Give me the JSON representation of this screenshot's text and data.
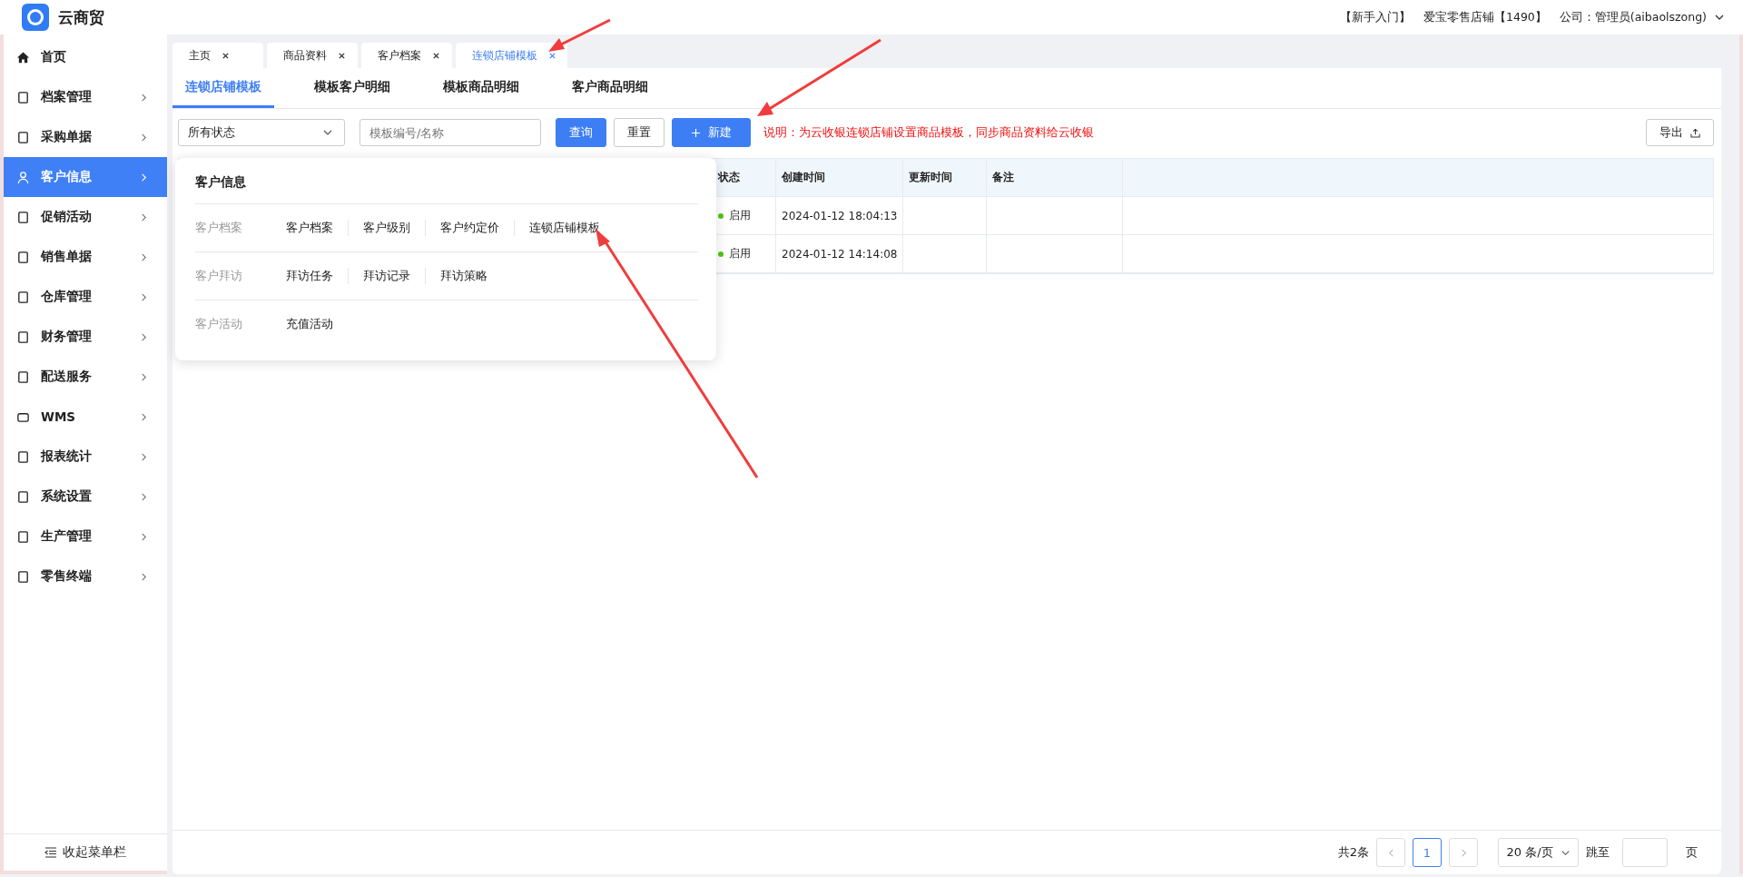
{
  "header": {
    "app_name": "云商贸",
    "links": [
      "【新手入门】",
      "爱宝零售店铺【1490】",
      "公司：管理员(aibaolszong)"
    ]
  },
  "sidebar": {
    "items": [
      {
        "label": "首页",
        "selected": false,
        "has_submenu": false
      },
      {
        "label": "档案管理",
        "selected": false,
        "has_submenu": true
      },
      {
        "label": "采购单据",
        "selected": false,
        "has_submenu": true
      },
      {
        "label": "客户信息",
        "selected": true,
        "has_submenu": true
      },
      {
        "label": "促销活动",
        "selected": false,
        "has_submenu": true
      },
      {
        "label": "销售单据",
        "selected": false,
        "has_submenu": true
      },
      {
        "label": "仓库管理",
        "selected": false,
        "has_submenu": true
      },
      {
        "label": "财务管理",
        "selected": false,
        "has_submenu": true
      },
      {
        "label": "配送服务",
        "selected": false,
        "has_submenu": true
      },
      {
        "label": "WMS",
        "selected": false,
        "has_submenu": true
      },
      {
        "label": "报表统计",
        "selected": false,
        "has_submenu": true
      },
      {
        "label": "系统设置",
        "selected": false,
        "has_submenu": true
      },
      {
        "label": "生产管理",
        "selected": false,
        "has_submenu": true
      },
      {
        "label": "零售终端",
        "selected": false,
        "has_submenu": true
      }
    ],
    "collapse_label": "收起菜单栏"
  },
  "page_tabs": [
    {
      "label": "主页",
      "selected": false
    },
    {
      "label": "商品资料",
      "selected": false
    },
    {
      "label": "客户档案",
      "selected": false
    },
    {
      "label": "连锁店铺模板",
      "selected": true
    }
  ],
  "sub_tabs": [
    {
      "label": "连锁店铺模板",
      "selected": true
    },
    {
      "label": "模板客户明细",
      "selected": false
    },
    {
      "label": "模板商品明细",
      "selected": false
    },
    {
      "label": "客户商品明细",
      "selected": false
    }
  ],
  "toolbar": {
    "status_select": "所有状态",
    "search": {
      "placeholder": "模板编号/名称"
    },
    "query_button": "查询",
    "reset_button": "重置",
    "new_button": "新建",
    "note": "说明：为云收银连锁店铺设置商品模板，同步商品资料给云收银",
    "export_button": "导出"
  },
  "table": {
    "columns": [
      "状态",
      "创建时间",
      "更新时间",
      "备注"
    ],
    "rows": [
      {
        "status": "启用",
        "color": "#52c41a",
        "created": "2024-01-12 18:04:13"
      },
      {
        "status": "启用",
        "color": "#52c41a",
        "created": "2024-01-12 14:14:08"
      }
    ]
  },
  "menu_popup": {
    "title": "客户信息",
    "groups": [
      {
        "label": "客户档案",
        "items": [
          "客户档案",
          "客户级别",
          "客户约定价",
          "连锁店铺模板"
        ]
      },
      {
        "label": "客户拜访",
        "items": [
          "拜访任务",
          "拜访记录",
          "拜访策略"
        ]
      },
      {
        "label": "客户活动",
        "items": [
          "充值活动"
        ]
      }
    ]
  },
  "pagination": {
    "total": "共2条",
    "current_page": "1",
    "page_size": "20 条/页",
    "jump_label": "跳至",
    "page_suffix": "页"
  }
}
